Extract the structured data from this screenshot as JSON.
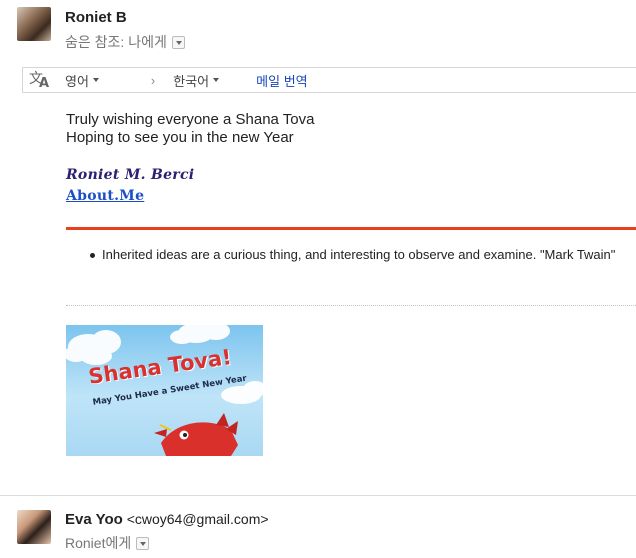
{
  "message1": {
    "sender_name": "Roniet B",
    "recipient_line": "숨은 참조: 나에게",
    "translate_bar": {
      "source_lang": "영어",
      "arrow": "›",
      "target_lang": "한국어",
      "translate_link": "메일 번역"
    },
    "body_lines": [
      "Truly wishing everyone a Shana Tova",
      "Hoping to see you in the new Year"
    ],
    "signature_name": "Roniet M. Berci",
    "signature_link": "About.Me",
    "quote": "Inherited ideas are a curious thing, and interesting to observe and examine. \"Mark Twain\"",
    "card": {
      "title": "Shana Tova!",
      "subtitle": "May You Have a Sweet New Year"
    }
  },
  "message2": {
    "sender_name": "Eva Yoo",
    "sender_email": "<cwoy64@gmail.com>",
    "recipient_line": "Roniet에게"
  },
  "colors": {
    "accent_rule": "#e8411c",
    "link": "#1a47b8",
    "signature": "#2b2170"
  }
}
